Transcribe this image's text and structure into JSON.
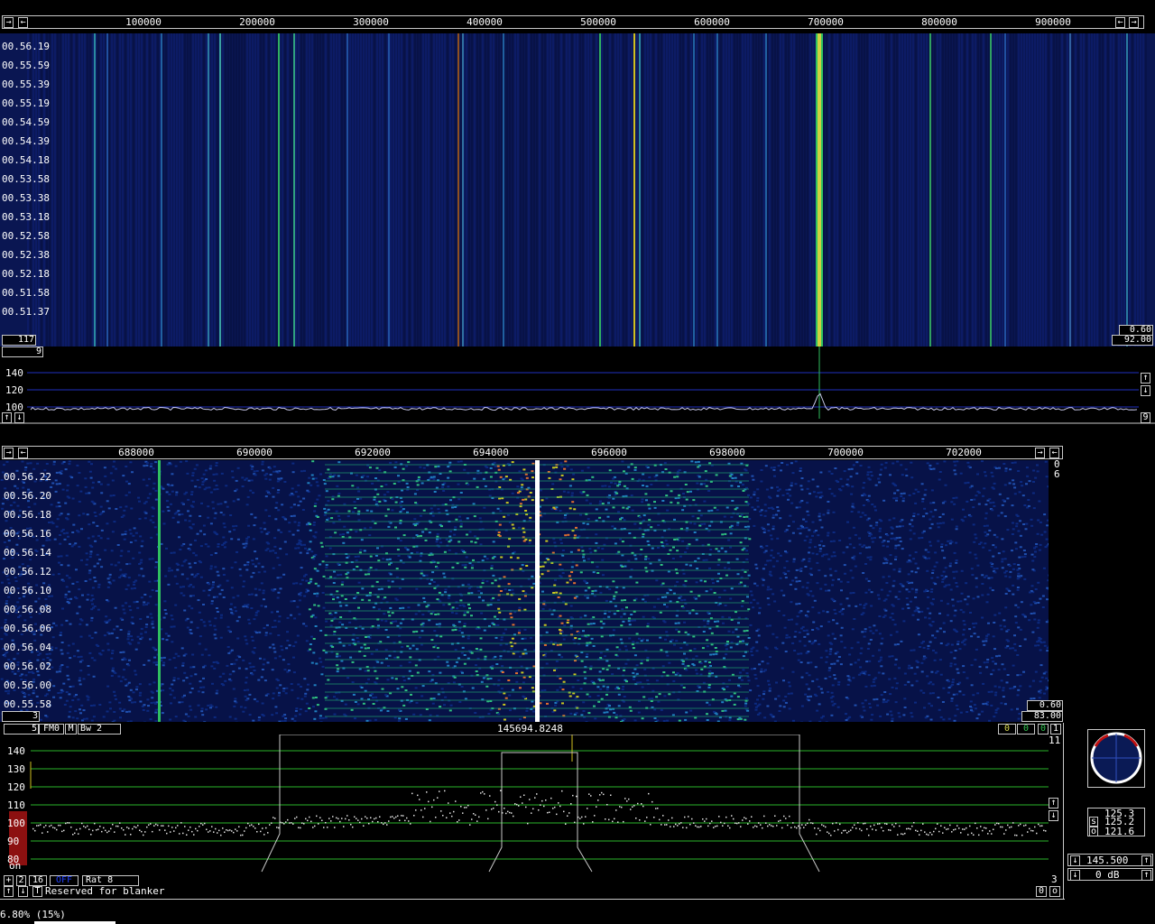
{
  "top_scale": {
    "ticks": [
      "100000",
      "200000",
      "300000",
      "400000",
      "500000",
      "600000",
      "700000",
      "800000",
      "900000"
    ],
    "left_arrow": "←",
    "right_arrow": "→",
    "start_arrow": "→"
  },
  "top_waterfall": {
    "times": [
      "00.56.19",
      "00.55.59",
      "00.55.39",
      "00.55.19",
      "00.54.59",
      "00.54.39",
      "00.54.18",
      "00.53.58",
      "00.53.38",
      "00.53.18",
      "00.52.58",
      "00.52.38",
      "00.52.18",
      "00.51.58",
      "00.51.37"
    ],
    "left_value": "117",
    "right_value_top": "0.60",
    "right_value_bottom": "92.00",
    "below_left_value": "9"
  },
  "top_spectrum": {
    "y_labels": [
      "140",
      "120",
      "100"
    ],
    "up_arrow": "↑",
    "down_arrow": "↓",
    "right_value": "9"
  },
  "bottom_scale": {
    "ticks": [
      "688000",
      "690000",
      "692000",
      "694000",
      "696000",
      "698000",
      "700000",
      "702000"
    ]
  },
  "bottom_waterfall": {
    "times": [
      "00.56.22",
      "00.56.20",
      "00.56.18",
      "00.56.16",
      "00.56.14",
      "00.56.12",
      "00.56.10",
      "00.56.08",
      "00.56.06",
      "00.56.04",
      "00.56.02",
      "00.56.00",
      "00.55.58"
    ],
    "right_top_a": "0",
    "right_top_b": "6",
    "left_value": "3",
    "right_value_top": "0.60",
    "right_value_bottom": "83.00"
  },
  "control_bar": {
    "num": "5",
    "mode": "FM0",
    "m": "M",
    "bw": "Bw 2",
    "frequency": "145694.8248",
    "right_boxes": [
      "0",
      "0",
      "0",
      "1"
    ],
    "right_small": "11"
  },
  "bottom_spectrum": {
    "y_labels": [
      "140",
      "130",
      "120",
      "110",
      "100",
      "90",
      "80"
    ],
    "on_label": "on",
    "right_value": "3"
  },
  "bottom_controls": {
    "plus": "+",
    "two": "2",
    "sixteen": "16",
    "off": "OFF",
    "rat": "Rat  8",
    "up": "↑",
    "down": "↓",
    "t": "T",
    "blanker_text": "Reserved for blanker",
    "right_a": "0",
    "right_b": "o"
  },
  "meter": {
    "s_label": "s",
    "o_label": "o",
    "value_top": "125.3",
    "value_s": "125.2",
    "value_o": "121.6"
  },
  "tuning": {
    "freq": "145.500",
    "gain": "0 dB"
  },
  "status": {
    "text": "6.80%  (15%)"
  },
  "colors": {
    "waterfall_bg": "#0a1450",
    "grid": "#2ab42a",
    "accent_red": "#8c1010",
    "blue_line": "#3050ff"
  }
}
